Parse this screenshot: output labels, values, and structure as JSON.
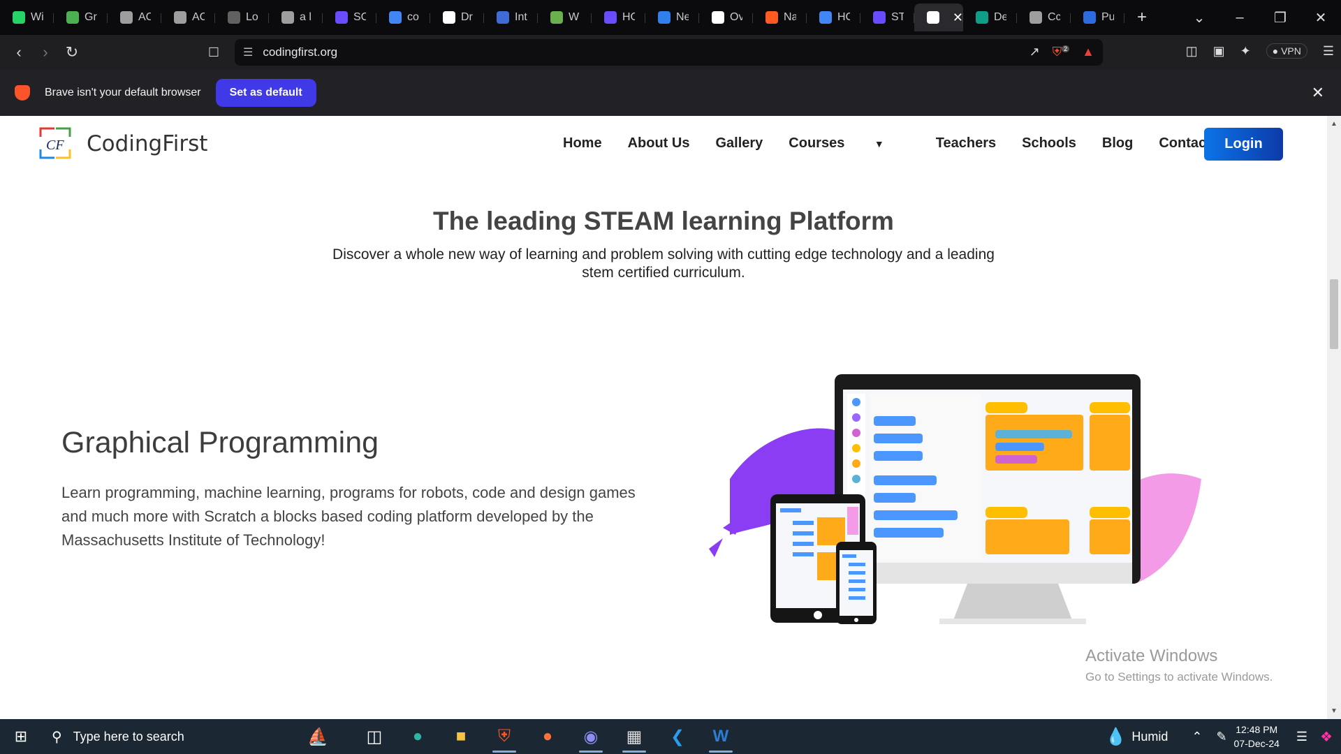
{
  "browser": {
    "tabs": [
      {
        "title": "Wi",
        "icon": "whatsapp-icon",
        "color": "#25d366"
      },
      {
        "title": "Gr",
        "icon": "leaf-icon",
        "color": "#4caf50"
      },
      {
        "title": "AC",
        "icon": "globe-icon",
        "color": "#9e9e9e"
      },
      {
        "title": "AC",
        "icon": "globe-icon",
        "color": "#9e9e9e"
      },
      {
        "title": "Lo",
        "icon": "globe-icon",
        "color": "#616161"
      },
      {
        "title": "a l",
        "icon": "plane-icon",
        "color": "#9e9e9e"
      },
      {
        "title": "SC",
        "icon": "list-icon",
        "color": "#6a4cff"
      },
      {
        "title": "co",
        "icon": "doc-icon",
        "color": "#4285f4"
      },
      {
        "title": "Dr",
        "icon": "github-icon",
        "color": "#ffffff"
      },
      {
        "title": "Int",
        "icon": "globe-icon",
        "color": "#3f6bd6"
      },
      {
        "title": "W",
        "icon": "circle-icon",
        "color": "#6ab04c"
      },
      {
        "title": "HC",
        "icon": "list-icon",
        "color": "#6a4cff"
      },
      {
        "title": "Ne",
        "icon": "globe-icon",
        "color": "#2f80ed"
      },
      {
        "title": "Ov",
        "icon": "news-icon",
        "color": "#ffffff"
      },
      {
        "title": "Na",
        "icon": "chart-icon",
        "color": "#ff5a1f"
      },
      {
        "title": "HC",
        "icon": "doc-icon",
        "color": "#4285f4"
      },
      {
        "title": "ST",
        "icon": "list-icon",
        "color": "#6a4cff"
      },
      {
        "title": "",
        "icon": "codingfirst-icon",
        "color": "#ffffff",
        "active": true
      },
      {
        "title": "De",
        "icon": "diamond-icon",
        "color": "#0f9d8a"
      },
      {
        "title": "Cc",
        "icon": "globe-icon",
        "color": "#9e9e9e"
      },
      {
        "title": "Pu",
        "icon": "play-icon",
        "color": "#2d6cdf"
      }
    ],
    "url": "codingfirst.org",
    "vpn_label": "VPN",
    "shield_count": "2"
  },
  "infobar": {
    "message": "Brave isn't your default browser",
    "button": "Set as default"
  },
  "site": {
    "brand": "CodingFirst",
    "nav": [
      "Home",
      "About Us",
      "Gallery",
      "Courses",
      "Teachers",
      "Schools",
      "Blog",
      "Contact Us"
    ],
    "login": "Login",
    "headline": "The leading STEAM learning Platform",
    "subhead": "Discover a whole new way of learning and problem solving with cutting edge technology and a leading stem certified curriculum.",
    "section_title": "Graphical Programming",
    "section_text": "Learn programming, machine learning, programs for robots, code and design games and much more with Scratch a blocks based coding platform developed by the Massachusetts Institute of Technology!"
  },
  "watermark": {
    "line1": "Activate Windows",
    "line2": "Go to Settings to activate Windows."
  },
  "taskbar": {
    "search_placeholder": "Type here to search",
    "weather": "Humid",
    "time": "12:48 PM",
    "date": "07-Dec-24"
  }
}
